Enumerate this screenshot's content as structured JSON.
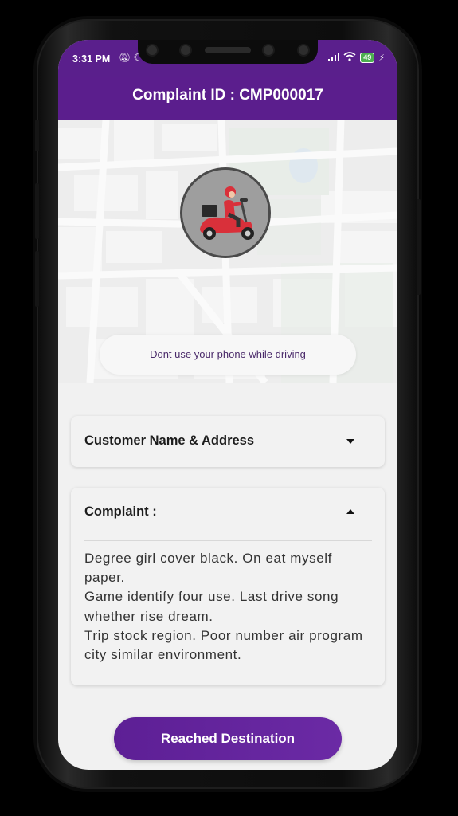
{
  "status_bar": {
    "time": "3:31 PM",
    "left_icons": [
      "alarm-off-icon",
      "moon-icon"
    ],
    "right_icons": [
      "signal-icon",
      "wifi-icon",
      "battery-icon",
      "charging-icon"
    ],
    "battery_level": "49"
  },
  "app_bar": {
    "title": "Complaint ID : CMP000017",
    "color": "#5b1e8d"
  },
  "rider_avatar": {
    "icon": "scooter-delivery-icon"
  },
  "notice": {
    "text": "Dont use your phone while driving"
  },
  "customer_card": {
    "title": "Customer Name & Address",
    "expanded": false
  },
  "complaint_card": {
    "title": "Complaint :",
    "expanded": true,
    "lines": [
      "Degree girl cover black. On eat myself paper.",
      "Game identify four use. Last drive song whether rise dream.",
      "Trip stock region. Poor number air program city similar environment."
    ]
  },
  "action_button": {
    "label": "Reached Destination"
  }
}
